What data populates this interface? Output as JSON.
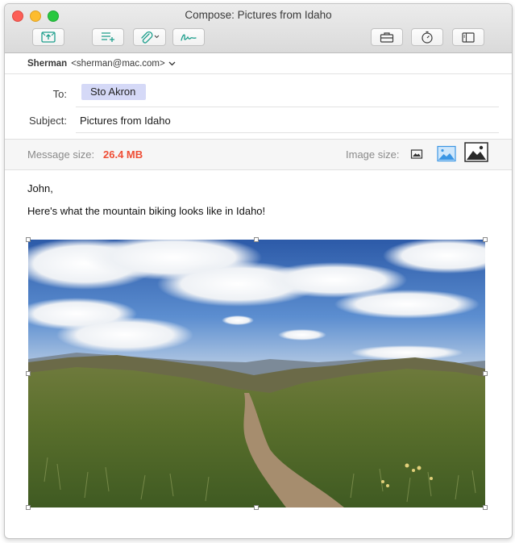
{
  "window": {
    "title": "Compose: Pictures from Idaho"
  },
  "toolbar": {
    "buttons": [
      {
        "name": "send-icon"
      },
      {
        "name": "format-text-icon"
      },
      {
        "name": "attachment-icon"
      },
      {
        "name": "signature-icon"
      },
      {
        "name": "photo-browser-icon"
      },
      {
        "name": "emoji-timer-icon"
      },
      {
        "name": "sidebar-icon"
      }
    ]
  },
  "from": {
    "name": "Sherman",
    "address": "<sherman@mac.com>"
  },
  "to": {
    "label": "To:",
    "recipient": "Sto Akron"
  },
  "subject": {
    "label": "Subject:",
    "value": "Pictures from Idaho"
  },
  "size_bar": {
    "message_label": "Message size:",
    "message_value": "26.4 MB",
    "image_label": "Image size:",
    "image_sizes": [
      "small",
      "medium",
      "large"
    ],
    "selected": "large"
  },
  "message": {
    "greeting": "John,",
    "line": "Here's what the mountain biking looks like in Idaho!"
  },
  "colors": {
    "accent": "#1d9e8c",
    "message_size": "#ef4e36",
    "token": "#d5d9f7"
  }
}
